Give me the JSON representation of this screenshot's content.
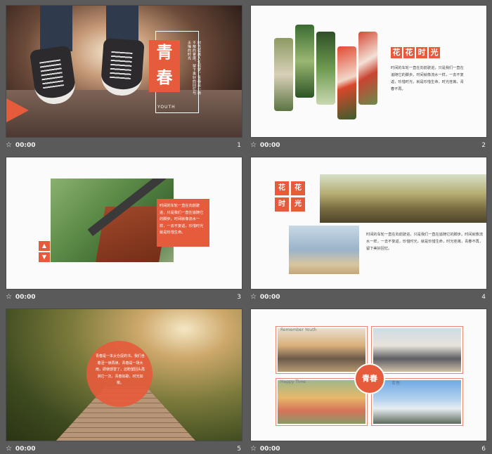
{
  "colors": {
    "accent": "#e55b3c",
    "background": "#5a5a5a",
    "slide": "#fbfbfb"
  },
  "footer": {
    "star_icon": "star-icon",
    "star_glyph": "☆"
  },
  "slides": [
    {
      "num": "1",
      "time": "00:00",
      "title_chars": [
        "青",
        "春"
      ],
      "subtitle": "YOUTH",
      "vertical_text": "时光荏苒人生如梦，青春是一场不散的宴席，留下美好的回忆与无悔的时光"
    },
    {
      "num": "2",
      "time": "00:00",
      "badge": [
        "花",
        "花",
        "时",
        "光"
      ],
      "body": "时间的车轮一直在向前驶进，只是我们一直在追随它的脚步。时间就像流水一样，一去不复返，珍惜时光，就是珍惜生命，时光荏苒，青春不再。"
    },
    {
      "num": "3",
      "time": "00:00",
      "body": "时间的车轮一直在向前驶进，只是我们一直在追随它的脚步。时间就像流水一样，一去不复返，珍惜时光就是珍惜生命。",
      "up_arrow": "▲",
      "down_arrow": "▼"
    },
    {
      "num": "4",
      "time": "00:00",
      "badge": [
        "花",
        "花",
        "时",
        "光"
      ],
      "body": "时间的车轮一直在向前驶进，只是我们一直在追随它的脚步。时间就像流水一样，一去不复返，珍惜时光，就是珍惜生命，时光荏苒，青春不再，留下美好回忆。"
    },
    {
      "num": "5",
      "time": "00:00",
      "body": "青春是一本太仓促的书，我们含着泪一读再读，青春是一场大雨，即使感冒了，还盼望回头再淋它一次。青春如歌，时光如梭。"
    },
    {
      "num": "6",
      "time": "00:00",
      "center": "青春",
      "captions": [
        "Remember Youth",
        "Happy Time",
        "青春"
      ]
    }
  ]
}
